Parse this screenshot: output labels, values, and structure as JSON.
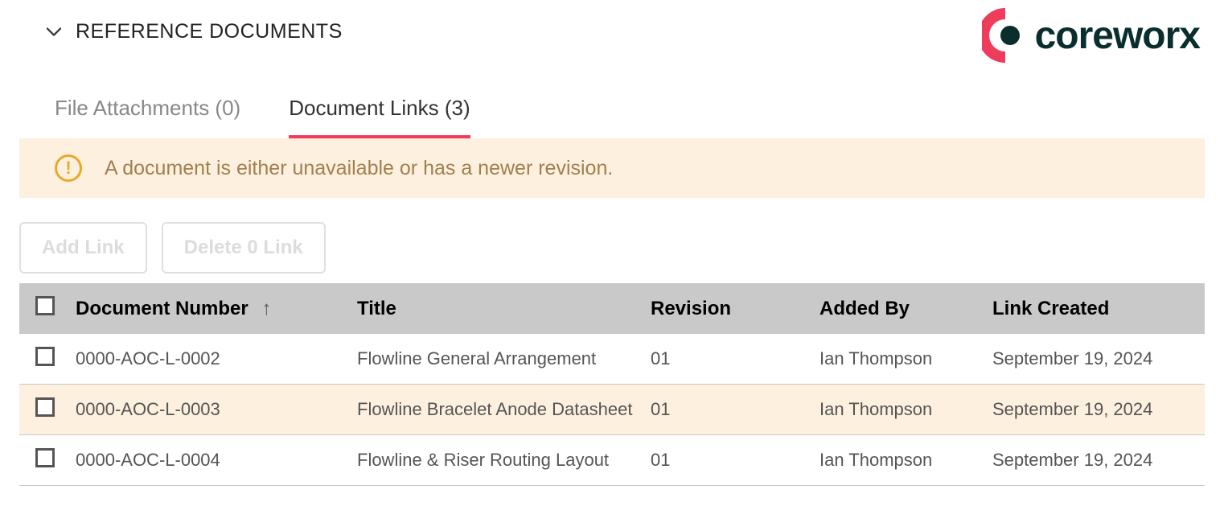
{
  "section": {
    "title": "REFERENCE DOCUMENTS"
  },
  "logo": {
    "text": "coreworx"
  },
  "tabs": {
    "attachments": "File Attachments (0)",
    "links": "Document Links (3)"
  },
  "alert": {
    "text": "A document is either unavailable or has a newer revision."
  },
  "actions": {
    "add": "Add Link",
    "delete": "Delete 0 Link"
  },
  "table": {
    "headers": {
      "docnum": "Document Number",
      "title": "Title",
      "revision": "Revision",
      "addedby": "Added By",
      "created": "Link Created"
    },
    "rows": [
      {
        "docnum": "0000-AOC-L-0002",
        "title": "Flowline General Arrangement",
        "revision": "01",
        "addedby": "Ian Thompson",
        "created": "September 19, 2024",
        "highlight": false
      },
      {
        "docnum": "0000-AOC-L-0003",
        "title": "Flowline Bracelet Anode Datasheet",
        "revision": "01",
        "addedby": "Ian Thompson",
        "created": "September 19, 2024",
        "highlight": true
      },
      {
        "docnum": "0000-AOC-L-0004",
        "title": "Flowline & Riser Routing Layout",
        "revision": "01",
        "addedby": "Ian Thompson",
        "created": "September 19, 2024",
        "highlight": false
      }
    ]
  }
}
